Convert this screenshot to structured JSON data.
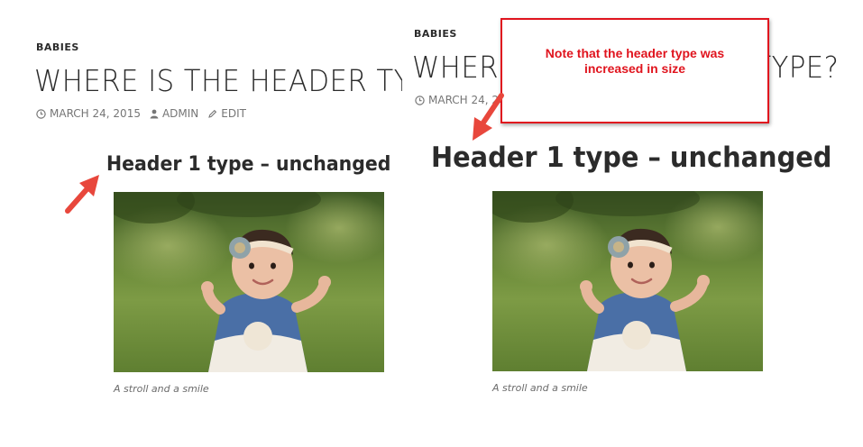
{
  "left": {
    "category": "BABIES",
    "title": "WHERE IS THE HEADER TY",
    "meta": {
      "date": "MARCH 24, 2015",
      "author": "ADMIN",
      "edit": "EDIT"
    },
    "heading": "Header 1 type – unchanged",
    "caption": "A stroll and a smile"
  },
  "right": {
    "category": "BABIES",
    "title": "WHERE IS THE HEADER TYPE?",
    "meta": {
      "date": "MARCH 24, 2015"
    },
    "heading": "Header 1 type – unchanged",
    "caption": "A stroll and a smile"
  },
  "callout": {
    "line1": "Note that the header type was",
    "line2": "increased in size"
  },
  "colors": {
    "annotation_red": "#e0141e",
    "arrow_red": "#e8473c",
    "text": "#2b2b2b",
    "meta": "#767676"
  },
  "icons": [
    "clock-icon",
    "user-icon",
    "pencil-icon"
  ]
}
